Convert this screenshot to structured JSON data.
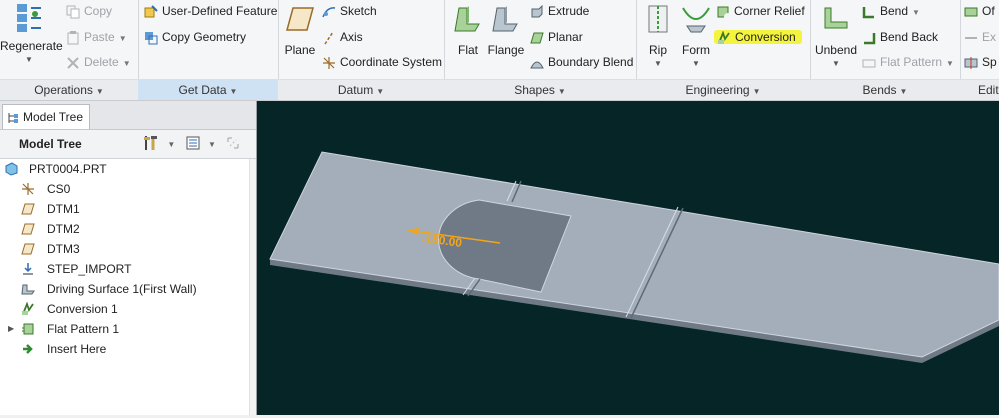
{
  "ribbon": {
    "operations": {
      "label": "Operations",
      "regenerate": "Regenerate",
      "copy": "Copy",
      "paste": "Paste",
      "delete": "Delete"
    },
    "get_data": {
      "label": "Get Data",
      "user_defined_feature": "User-Defined Feature",
      "copy_geometry": "Copy Geometry"
    },
    "datum": {
      "label": "Datum",
      "plane": "Plane",
      "sketch": "Sketch",
      "axis": "Axis",
      "coordinate_system": "Coordinate System"
    },
    "shapes": {
      "label": "Shapes",
      "flat": "Flat",
      "flange": "Flange",
      "extrude": "Extrude",
      "planar": "Planar",
      "boundary_blend": "Boundary Blend"
    },
    "engineering": {
      "label": "Engineering",
      "rip": "Rip",
      "form": "Form",
      "corner_relief": "Corner Relief",
      "conversion": "Conversion"
    },
    "bends": {
      "label": "Bends",
      "unbend": "Unbend",
      "bend": "Bend",
      "bend_back": "Bend Back",
      "flat_pattern": "Flat Pattern"
    },
    "editing": {
      "label": "Edit",
      "offset": "Of",
      "extend": "Ex",
      "split": "Sp"
    }
  },
  "panel": {
    "tab": "Model Tree",
    "header": "Model Tree",
    "items": [
      {
        "label": "PRT0004.PRT",
        "icon": "part-icon"
      },
      {
        "label": "CS0",
        "icon": "coordinate-system-icon"
      },
      {
        "label": "DTM1",
        "icon": "datum-plane-icon"
      },
      {
        "label": "DTM2",
        "icon": "datum-plane-icon"
      },
      {
        "label": "DTM3",
        "icon": "datum-plane-icon"
      },
      {
        "label": "STEP_IMPORT",
        "icon": "import-icon"
      },
      {
        "label": "Driving Surface 1(First Wall)",
        "icon": "driving-surface-icon"
      },
      {
        "label": "Conversion 1",
        "icon": "conversion-icon"
      },
      {
        "label": "Flat Pattern 1",
        "icon": "flat-pattern-icon"
      },
      {
        "label": "Insert Here",
        "icon": "insert-arrow-icon"
      }
    ]
  },
  "viewport": {
    "dimension": "180.00"
  },
  "colors": {
    "viewport_bg": "#052527",
    "sheet_fill": "#a4aebb",
    "highlight": "#f4f33d",
    "dimension": "#f2a51a"
  }
}
